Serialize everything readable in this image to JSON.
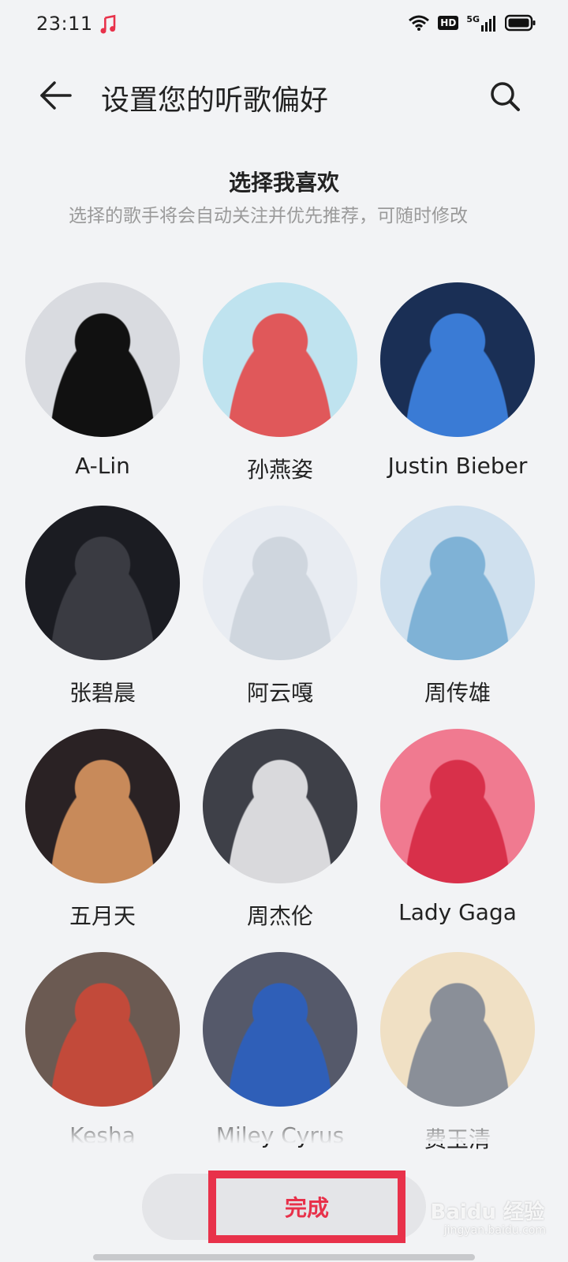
{
  "status_bar": {
    "time": "23:11",
    "hd_label": "HD",
    "network_label": "5G"
  },
  "header": {
    "title": "设置您的听歌偏好",
    "back_icon": "back-arrow-icon",
    "search_icon": "search-icon"
  },
  "section": {
    "title": "选择我喜欢",
    "subtitle": "选择的歌手将会自动关注并优先推荐，可随时修改"
  },
  "artists": [
    {
      "name": "A-Lin",
      "bg": "#d9dbe0",
      "accent": "#111111"
    },
    {
      "name": "孙燕姿",
      "bg": "#bfe3ef",
      "accent": "#e0585a"
    },
    {
      "name": "Justin Bieber",
      "bg": "#1a2f55",
      "accent": "#3a7bd5"
    },
    {
      "name": "张碧晨",
      "bg": "#1b1c22",
      "accent": "#3a3b42"
    },
    {
      "name": "阿云嘎",
      "bg": "#e8ecf2",
      "accent": "#cfd6de"
    },
    {
      "name": "周传雄",
      "bg": "#cfe0ee",
      "accent": "#7fb2d6"
    },
    {
      "name": "五月天",
      "bg": "#2a2224",
      "accent": "#c88a5a"
    },
    {
      "name": "周杰伦",
      "bg": "#3e4048",
      "accent": "#d9d9dc"
    },
    {
      "name": "Lady Gaga",
      "bg": "#f07a90",
      "accent": "#d8304a"
    },
    {
      "name": "Kesha",
      "bg": "#6b5a52",
      "accent": "#c24a3a"
    },
    {
      "name": "Miley Cyrus",
      "bg": "#55596a",
      "accent": "#2f5fb8"
    },
    {
      "name": "费玉清",
      "bg": "#f0e0c4",
      "accent": "#8a8f98"
    }
  ],
  "bottom": {
    "done_label": "完成"
  },
  "watermark": {
    "text": "Baidu 经验",
    "sub": "jingyan.baidu.com"
  }
}
